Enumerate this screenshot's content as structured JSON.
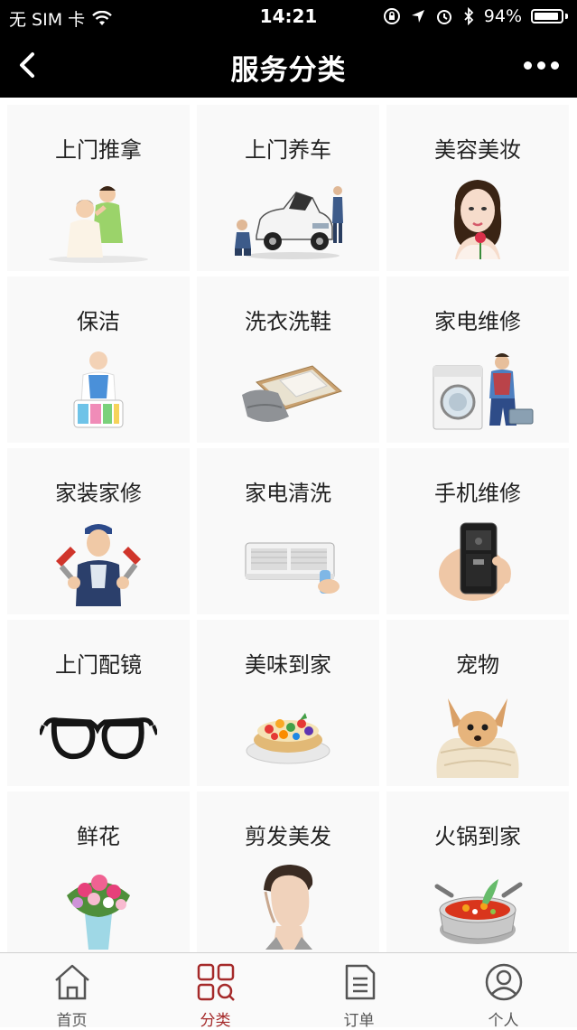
{
  "status": {
    "carrier": "无 SIM 卡",
    "time": "14:21",
    "battery_percent": "94%",
    "battery_level": 0.94
  },
  "nav": {
    "title": "服务分类"
  },
  "categories": [
    {
      "label": "上门推拿",
      "icon": "massage-icon"
    },
    {
      "label": "上门养车",
      "icon": "car-maintenance-icon"
    },
    {
      "label": "美容美妆",
      "icon": "beauty-makeup-icon"
    },
    {
      "label": "保洁",
      "icon": "cleaning-icon"
    },
    {
      "label": "洗衣洗鞋",
      "icon": "laundry-icon"
    },
    {
      "label": "家电维修",
      "icon": "appliance-repair-icon"
    },
    {
      "label": "家装家修",
      "icon": "home-repair-icon"
    },
    {
      "label": "家电清洗",
      "icon": "appliance-cleaning-icon"
    },
    {
      "label": "手机维修",
      "icon": "phone-repair-icon"
    },
    {
      "label": "上门配镜",
      "icon": "eyeglasses-icon"
    },
    {
      "label": "美味到家",
      "icon": "food-delivery-icon"
    },
    {
      "label": "宠物",
      "icon": "pet-icon"
    },
    {
      "label": "鲜花",
      "icon": "flowers-icon"
    },
    {
      "label": "剪发美发",
      "icon": "haircut-icon"
    },
    {
      "label": "火锅到家",
      "icon": "hotpot-icon"
    }
  ],
  "tabs": [
    {
      "label": "首页",
      "icon": "home-icon",
      "active": false
    },
    {
      "label": "分类",
      "icon": "category-grid-icon",
      "active": true
    },
    {
      "label": "订单",
      "icon": "order-document-icon",
      "active": false
    },
    {
      "label": "个人",
      "icon": "user-profile-icon",
      "active": false
    }
  ],
  "colors": {
    "nav_background": "#000000",
    "accent": "#a52a2a",
    "tab_inactive": "#555555"
  }
}
